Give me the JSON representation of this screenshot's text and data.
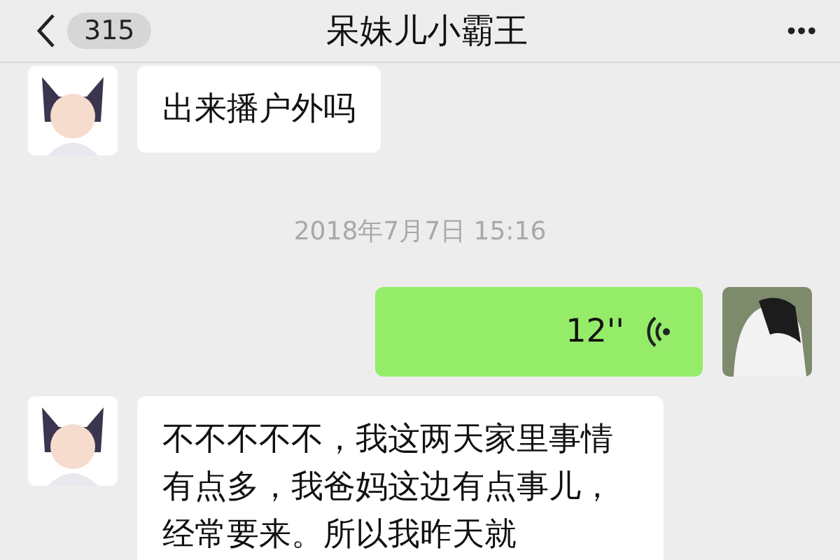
{
  "header": {
    "back_count": "315",
    "title": "呆妹儿小霸王",
    "more": "•••"
  },
  "messages": [
    {
      "kind": "text",
      "outgoing": false,
      "text": "出来播户外吗"
    },
    {
      "kind": "time",
      "text": "2018年7月7日 15:16"
    },
    {
      "kind": "voice",
      "outgoing": true,
      "duration": "12''"
    },
    {
      "kind": "text",
      "outgoing": false,
      "text": "不不不不不，我这两天家里事情有点多，我爸妈这边有点事儿，经常要来。所以我昨天就"
    }
  ]
}
